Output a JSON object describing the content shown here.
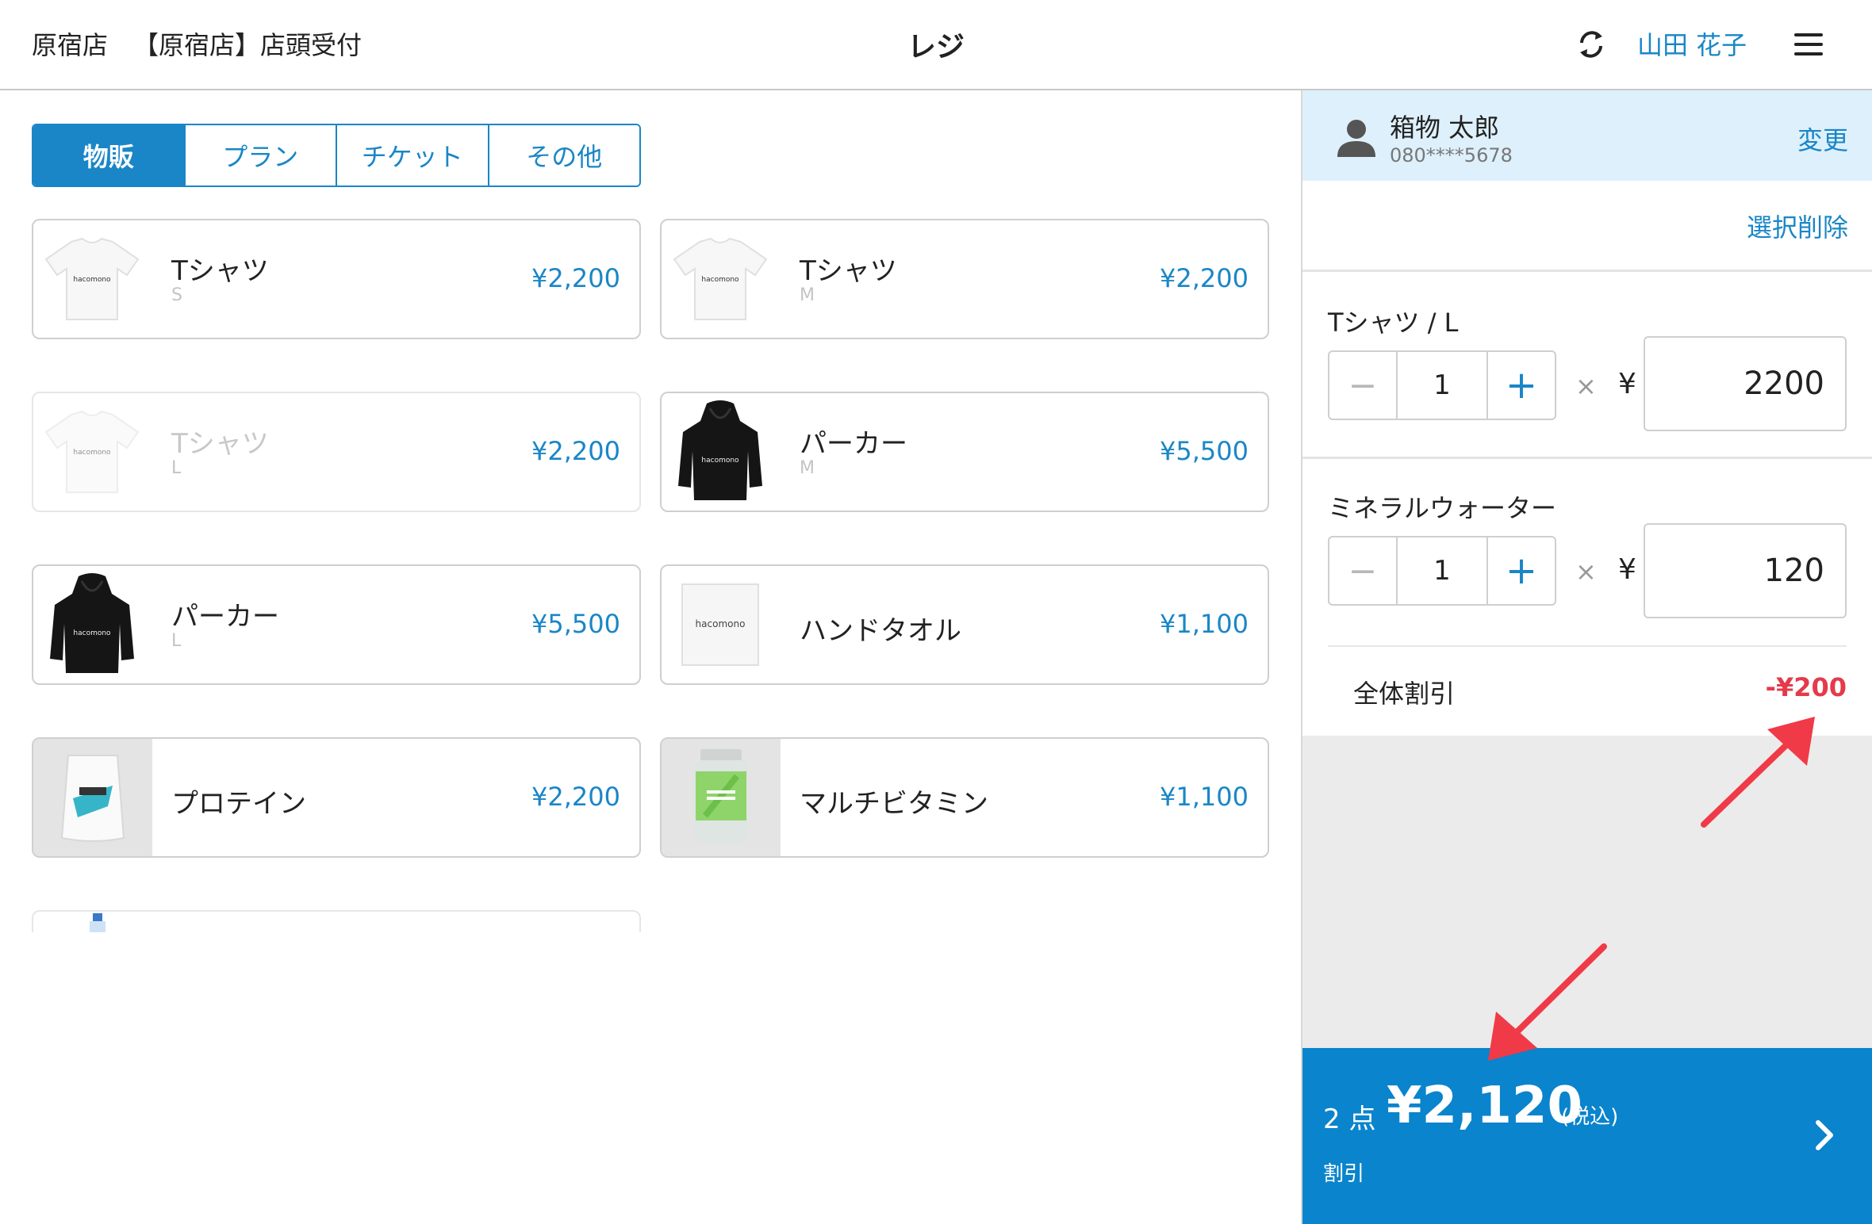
{
  "header": {
    "store": "原宿店",
    "counter": "【原宿店】店頭受付",
    "title": "レジ",
    "user": "山田 花子",
    "sync_icon": "sync-icon",
    "menu_icon": "hamburger-menu-icon"
  },
  "tabs": [
    {
      "label": "物販",
      "active": true
    },
    {
      "label": "プラン",
      "active": false
    },
    {
      "label": "チケット",
      "active": false
    },
    {
      "label": "その他",
      "active": false
    }
  ],
  "products": [
    {
      "name": "Tシャツ",
      "variant": "S",
      "price": "¥2,200",
      "image": "tshirt",
      "disabled": false
    },
    {
      "name": "Tシャツ",
      "variant": "M",
      "price": "¥2,200",
      "image": "tshirt",
      "disabled": false
    },
    {
      "name": "Tシャツ",
      "variant": "L",
      "price": "¥2,200",
      "image": "tshirt",
      "disabled": true
    },
    {
      "name": "パーカー",
      "variant": "M",
      "price": "¥5,500",
      "image": "hoodie",
      "disabled": false
    },
    {
      "name": "パーカー",
      "variant": "L",
      "price": "¥5,500",
      "image": "hoodie",
      "disabled": false
    },
    {
      "name": "ハンドタオル",
      "variant": "",
      "price": "¥1,100",
      "image": "towel",
      "disabled": false
    },
    {
      "name": "プロテイン",
      "variant": "",
      "price": "¥2,200",
      "image": "protein",
      "disabled": false
    },
    {
      "name": "マルチビタミン",
      "variant": "",
      "price": "¥1,100",
      "image": "vitamin",
      "disabled": false
    }
  ],
  "brand_text": "hacomono",
  "customer": {
    "name": "箱物 太郎",
    "phone": "080****5678",
    "change_label": "変更"
  },
  "cart": {
    "clear_selected_label": "選択削除",
    "items": [
      {
        "title": "Tシャツ / L",
        "qty": "1",
        "times": "×",
        "yen": "¥",
        "price": "2200"
      },
      {
        "title": "ミネラルウォーター",
        "qty": "1",
        "times": "×",
        "yen": "¥",
        "price": "120"
      }
    ],
    "discount_label": "全体割引",
    "discount_value": "-¥200"
  },
  "footer": {
    "count": "2 点",
    "total": "¥2,120",
    "tax_note": "(税込)",
    "discount_note": "割引",
    "next_icon": "chevron-right-icon"
  },
  "colors": {
    "accent": "#1a86c7",
    "footer_bg": "#0a84cc",
    "discount": "#e53a4a",
    "annotation_arrow": "#f03a47"
  }
}
